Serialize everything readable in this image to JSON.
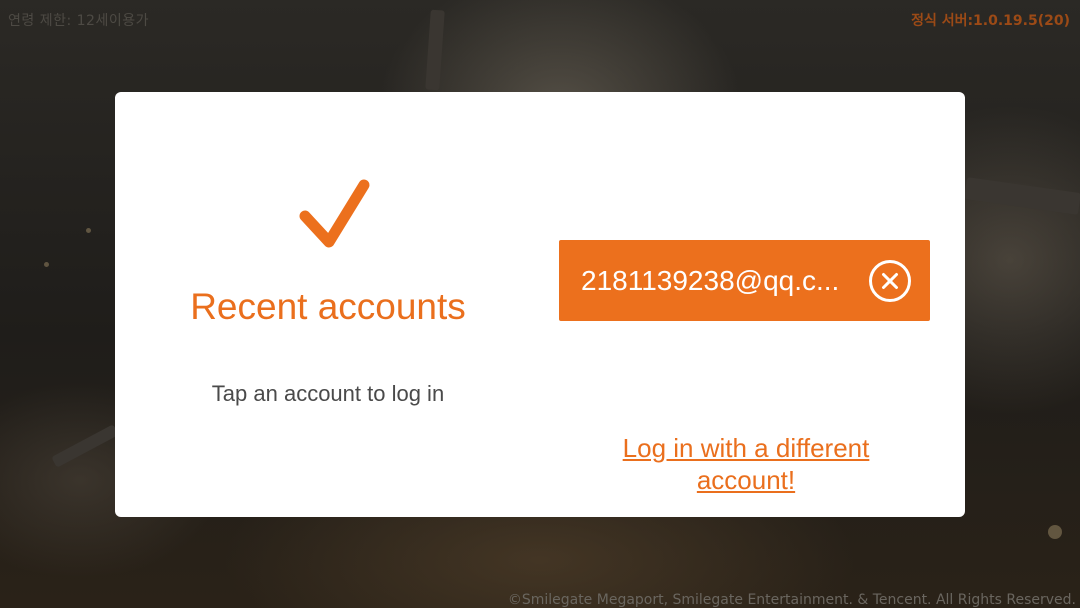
{
  "header": {
    "age_limit": "연령 제한: 12세이용가",
    "server_info": "정식 서버:1.0.19.5(20)"
  },
  "dialog": {
    "check_icon": "checkmark-icon",
    "title": "Recent accounts",
    "subtitle": "Tap an account to log in",
    "account": {
      "label": "2181139238@qq.c...",
      "remove_icon": "close-circle-icon"
    },
    "different_account_link": "Log in with a different account!"
  },
  "footer": {
    "copyright": "©Smilegate Megaport, Smilegate Entertainment. & Tencent. All Rights Reserved."
  },
  "colors": {
    "accent": "#ec701d",
    "dialog_bg": "#ffffff",
    "text_muted": "#4a4a4a"
  }
}
